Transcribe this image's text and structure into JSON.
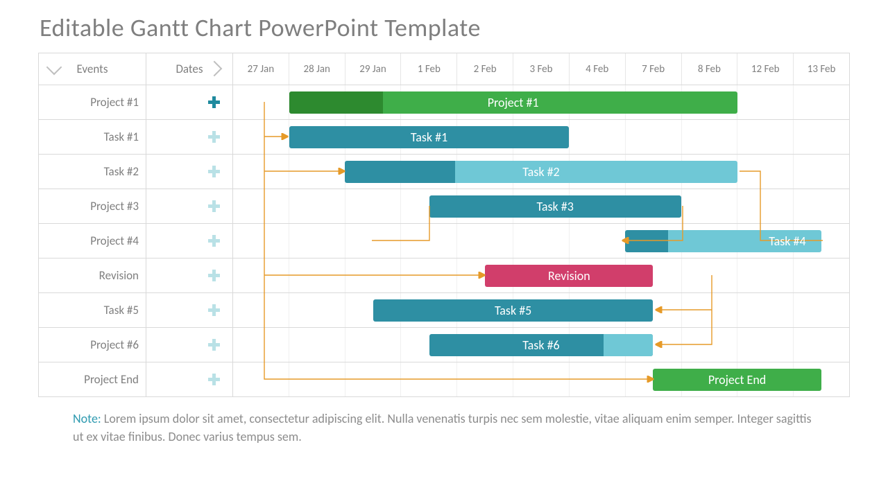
{
  "title": "Editable Gantt Chart PowerPoint Template",
  "header": {
    "events": "Events",
    "dates": "Dates"
  },
  "dates": [
    "27 Jan",
    "28 Jan",
    "29 Jan",
    "1 Feb",
    "2 Feb",
    "3 Feb",
    "4 Feb",
    "7 Feb",
    "8 Feb",
    "12 Feb",
    "13 Feb"
  ],
  "rows": [
    {
      "label": "Project #1",
      "plus": "teal",
      "bar": {
        "text": "Project #1",
        "start": 1,
        "span": 8,
        "color": "#3fae49",
        "prog": 0.21,
        "progColor": "#2d8a2f"
      }
    },
    {
      "label": "Task #1",
      "plus": "light",
      "bar": {
        "text": "Task #1",
        "start": 1,
        "span": 5,
        "color": "#2e8fa3"
      }
    },
    {
      "label": "Task #2",
      "plus": "light",
      "bar": {
        "text": "Task #2",
        "start": 2,
        "span": 7,
        "color": "#6fc8d6",
        "prog": 0.28,
        "progColor": "#2e8fa3"
      }
    },
    {
      "label": "Project #3",
      "plus": "light",
      "bar": {
        "text": "Task #3",
        "start": 3.5,
        "span": 4.5,
        "color": "#2e8fa3"
      }
    },
    {
      "label": "Project #4",
      "plus": "light",
      "bar": {
        "text": "Task #4",
        "start": 7,
        "span": 3.5,
        "color": "#6fc8d6",
        "prog": 0.22,
        "progColor": "#2e8fa3",
        "align": "right"
      }
    },
    {
      "label": "Revision",
      "plus": "light",
      "bar": {
        "text": "Revision",
        "start": 4.5,
        "span": 3,
        "color": "#d13e6b"
      }
    },
    {
      "label": "Task #5",
      "plus": "light",
      "bar": {
        "text": "Task #5",
        "start": 2.5,
        "span": 5,
        "color": "#2e8fa3"
      }
    },
    {
      "label": "Project #6",
      "plus": "light",
      "bar": {
        "text": "Task #6",
        "start": 3.5,
        "span": 4,
        "color": "#2e8fa3",
        "prog2": 0.22,
        "prog2Color": "#6fc8d6"
      }
    },
    {
      "label": "Project End",
      "plus": "light",
      "bar": {
        "text": "Project End",
        "start": 7.5,
        "span": 3,
        "color": "#3fae49"
      }
    }
  ],
  "note": {
    "lead": "Note:",
    "body": " Lorem ipsum dolor sit amet, consectetur adipiscing elit. Nulla venenatis turpis nec sem molestie, vitae aliquam enim semper. Integer sagittis ut ex vitae finibus. Donec varius tempus sem."
  },
  "chart_data": {
    "type": "gantt",
    "title": "Editable Gantt Chart PowerPoint Template",
    "x_categories": [
      "27 Jan",
      "28 Jan",
      "29 Jan",
      "1 Feb",
      "2 Feb",
      "3 Feb",
      "4 Feb",
      "7 Feb",
      "8 Feb",
      "12 Feb",
      "13 Feb"
    ],
    "tasks": [
      {
        "row_label": "Project #1",
        "bar_label": "Project #1",
        "start": "28 Jan",
        "end": "8 Feb",
        "color": "green",
        "progress": 0.21
      },
      {
        "row_label": "Task #1",
        "bar_label": "Task #1",
        "start": "28 Jan",
        "end": "3 Feb",
        "color": "teal"
      },
      {
        "row_label": "Task #2",
        "bar_label": "Task #2",
        "start": "29 Jan",
        "end": "8 Feb",
        "color": "light-teal",
        "progress": 0.28
      },
      {
        "row_label": "Project #3",
        "bar_label": "Task #3",
        "start": "1 Feb",
        "end": "7 Feb",
        "color": "teal"
      },
      {
        "row_label": "Project #4",
        "bar_label": "Task #4",
        "start": "7 Feb",
        "end": "13 Feb",
        "color": "light-teal",
        "progress": 0.22
      },
      {
        "row_label": "Revision",
        "bar_label": "Revision",
        "start": "2 Feb",
        "end": "4 Feb",
        "color": "pink"
      },
      {
        "row_label": "Task #5",
        "bar_label": "Task #5",
        "start": "29 Jan",
        "end": "4 Feb",
        "color": "teal"
      },
      {
        "row_label": "Project #6",
        "bar_label": "Task #6",
        "start": "1 Feb",
        "end": "4 Feb",
        "color": "teal"
      },
      {
        "row_label": "Project End",
        "bar_label": "Project End",
        "start": "7 Feb",
        "end": "13 Feb",
        "color": "green"
      }
    ],
    "dependencies": [
      [
        "Project #1",
        "Task #1"
      ],
      [
        "Project #1",
        "Task #2"
      ],
      [
        "Project #1",
        "Revision"
      ],
      [
        "Project #1",
        "Project End"
      ],
      [
        "Task #2",
        "Task #4"
      ],
      [
        "Task #3",
        "Task #4"
      ],
      [
        "Revision",
        "Task #5"
      ],
      [
        "Revision",
        "Task #6"
      ]
    ]
  }
}
